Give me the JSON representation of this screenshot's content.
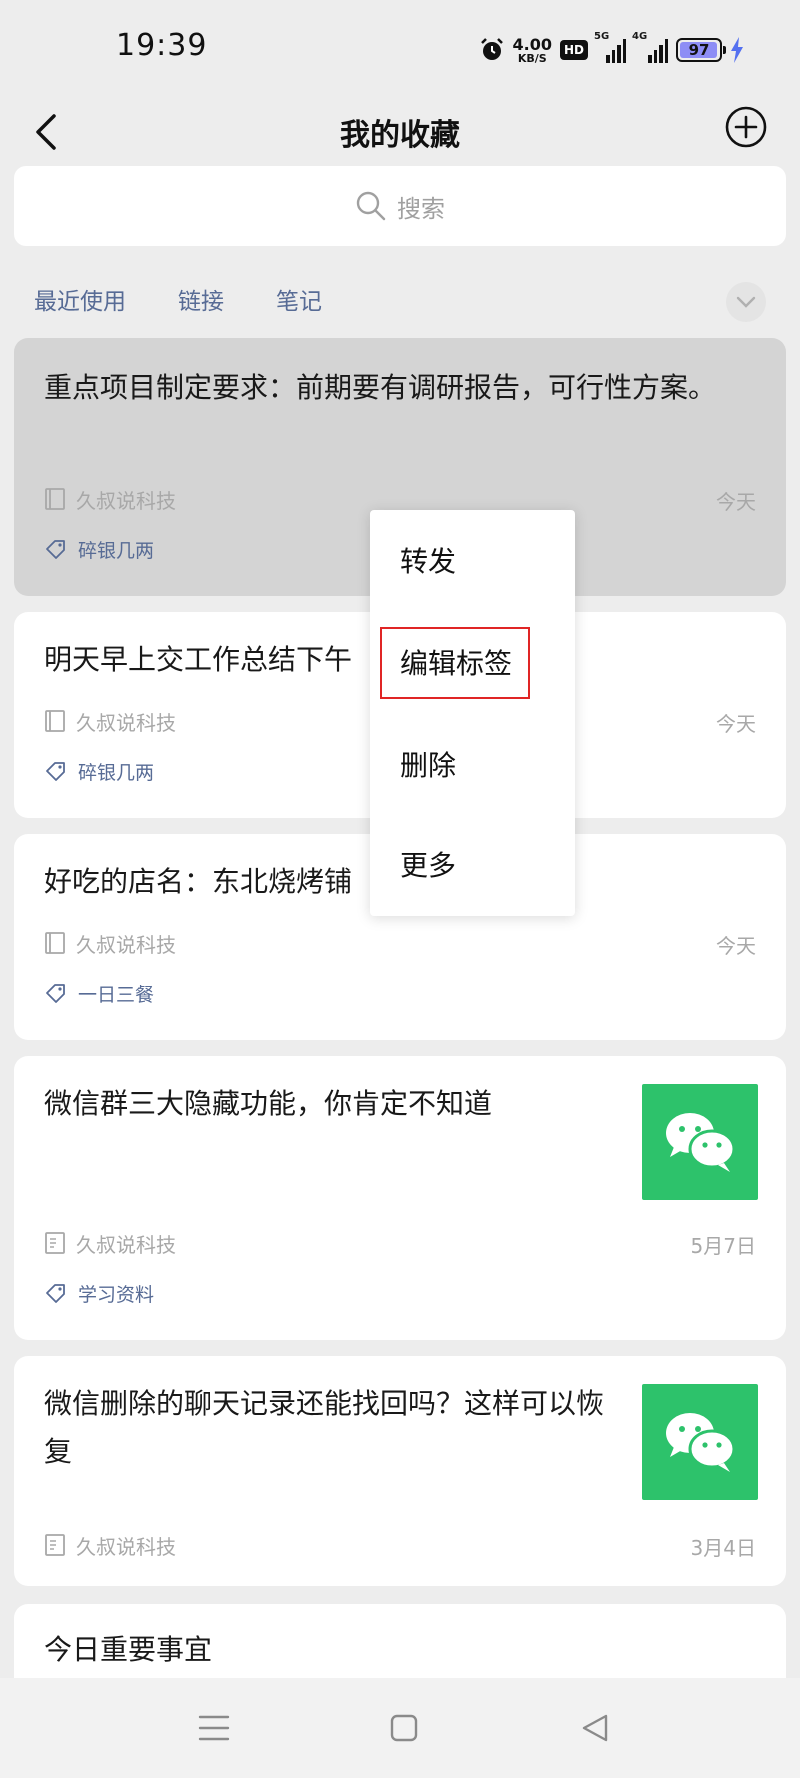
{
  "status_bar": {
    "time": "19:39",
    "net_speed_value": "4.00",
    "net_speed_unit": "KB/S",
    "hd_label": "HD",
    "signal_1_label": "5G",
    "signal_2_label": "4G",
    "battery": "97"
  },
  "nav": {
    "title": "我的收藏"
  },
  "search": {
    "placeholder": "搜索"
  },
  "tabs": [
    {
      "label": "最近使用"
    },
    {
      "label": "链接"
    },
    {
      "label": "笔记"
    }
  ],
  "items": [
    {
      "title": "重点项目制定要求：前期要有调研报告，可行性方案。",
      "source": "久叔说科技",
      "date": "今天",
      "tag": "碎银几两"
    },
    {
      "title": "明天早上交工作总结下午",
      "source": "久叔说科技",
      "date": "今天",
      "tag": "碎银几两"
    },
    {
      "title": "好吃的店名：东北烧烤铺",
      "source": "久叔说科技",
      "date": "今天",
      "tag": "一日三餐"
    },
    {
      "title": "微信群三大隐藏功能，你肯定不知道",
      "source": "久叔说科技",
      "date": "5月7日",
      "tag": "学习资料"
    },
    {
      "title": "微信删除的聊天记录还能找回吗？这样可以恢复",
      "source": "久叔说科技",
      "date": "3月4日"
    },
    {
      "title": "今日重要事宜"
    }
  ],
  "context_menu": {
    "items": [
      {
        "label": "转发"
      },
      {
        "label": "编辑标签"
      },
      {
        "label": "删除"
      },
      {
        "label": "更多"
      }
    ],
    "highlighted": "编辑标签"
  },
  "colors": {
    "accent_blue": "#576b95",
    "wechat_green": "#2dc26b",
    "highlight_red": "#e02525"
  }
}
